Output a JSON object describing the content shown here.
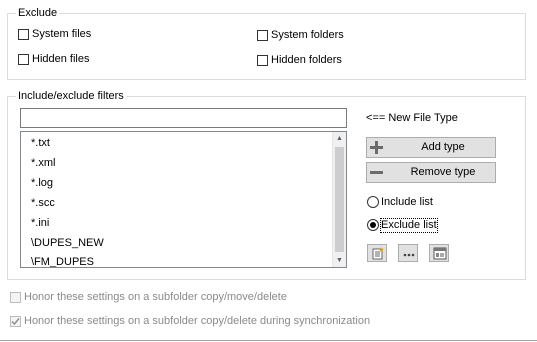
{
  "exclude": {
    "title": "Exclude",
    "options": [
      {
        "label": "System files",
        "checked": false
      },
      {
        "label": "System folders",
        "checked": false
      },
      {
        "label": "Hidden files",
        "checked": false
      },
      {
        "label": "Hidden folders",
        "checked": false
      }
    ]
  },
  "filters": {
    "title": "Include/exclude filters",
    "new_type_value": "",
    "new_type_hint": "<== New File Type",
    "add_label": "Add type",
    "remove_label": "Remove type",
    "items": [
      "*.txt",
      "*.xml",
      "*.log",
      "*.scc",
      "*.ini",
      "\\DUPES_NEW",
      "\\FM_DUPES"
    ],
    "include_label": "Include list",
    "exclude_label": "Exclude list",
    "selected_mode": "Exclude list"
  },
  "honor": {
    "copy_move_delete": {
      "label": "Honor these settings on a subfolder copy/move/delete",
      "checked": false,
      "enabled": false
    },
    "sync": {
      "label": "Honor these settings on a subfolder copy/delete during synchronization",
      "checked": true,
      "enabled": false
    }
  },
  "icons": [
    "plus-icon",
    "minus-icon",
    "new-list-icon",
    "more-icon",
    "list-view-icon"
  ]
}
